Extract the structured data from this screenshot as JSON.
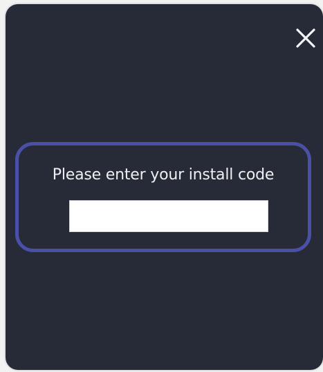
{
  "dialog": {
    "close_icon": "close-icon",
    "prompt": "Please enter your install code",
    "install_code": {
      "value": "",
      "placeholder": ""
    }
  },
  "colors": {
    "dialog_background": "#262b37",
    "highlight_border": "#4a50a6",
    "text": "#eef0f3",
    "input_background": "#ffffff"
  }
}
